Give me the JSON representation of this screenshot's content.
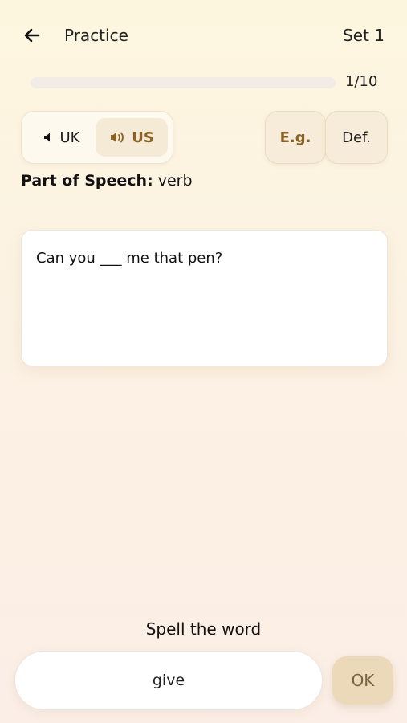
{
  "header": {
    "title": "Practice",
    "set_label": "Set 1"
  },
  "progress": {
    "text": "1/10",
    "fraction": 0.0
  },
  "audio": {
    "uk_label": "UK",
    "us_label": "US",
    "selected": "US"
  },
  "chips": {
    "example_label": "E.g.",
    "definition_label": "Def."
  },
  "part_of_speech": {
    "label": "Part of Speech:",
    "value": "verb"
  },
  "sentence": {
    "text": "Can you ___ me that pen?"
  },
  "answer": {
    "prompt": "Spell the word",
    "value": "give",
    "ok_label": "OK"
  },
  "colors": {
    "accent": "#8a6226",
    "chip_bg": "#f7ecd9",
    "ok_bg": "#ecd9b9"
  },
  "icons": {
    "back": "arrow-left-icon",
    "uk": "speaker-icon",
    "us": "speaker-wave-icon"
  }
}
